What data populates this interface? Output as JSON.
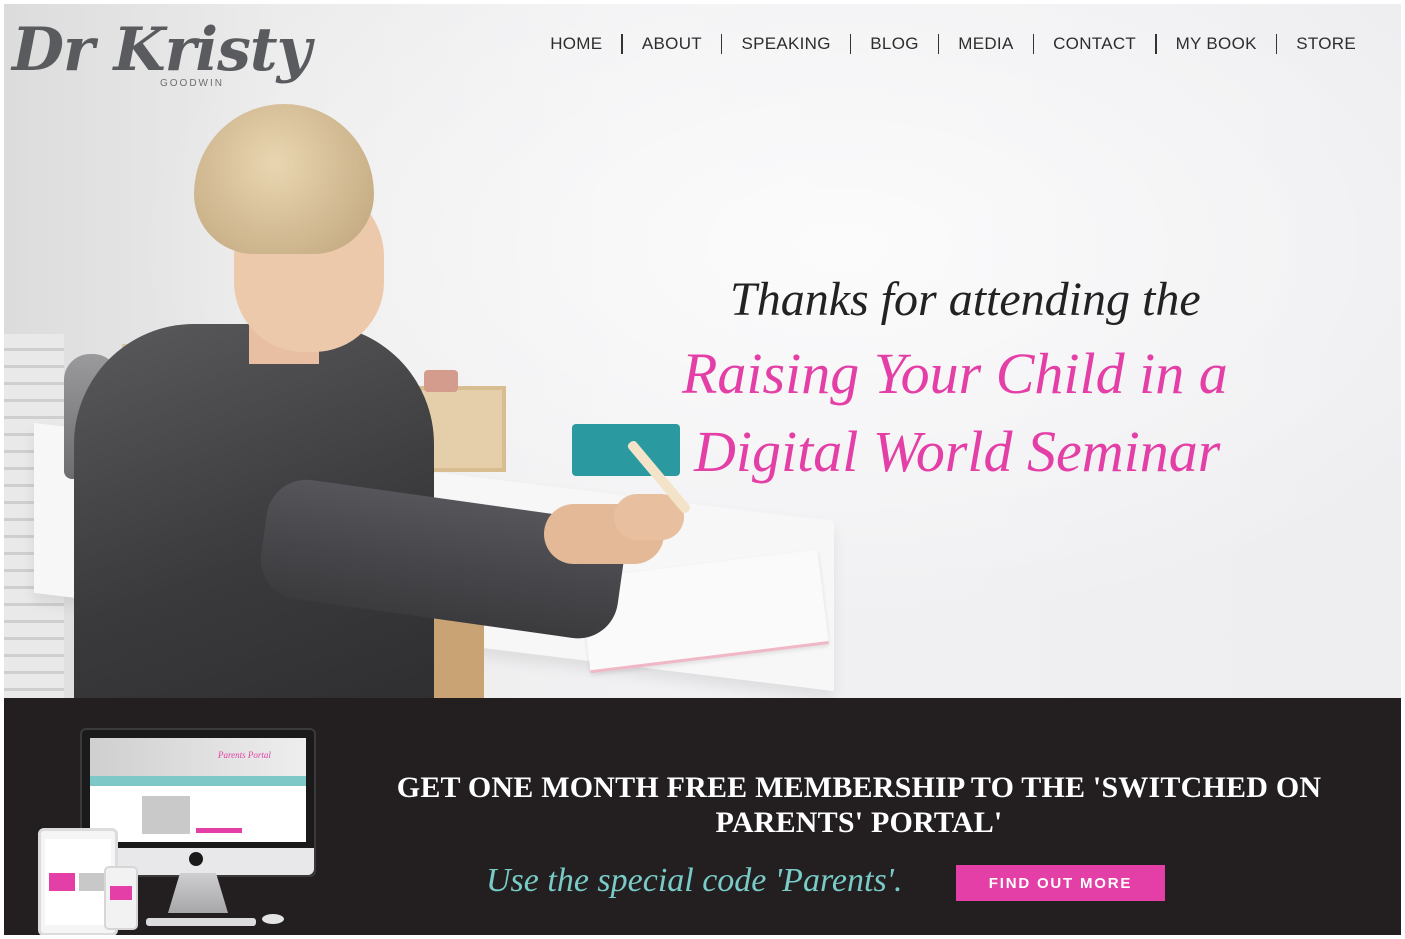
{
  "logo": {
    "main": "Dr Kristy",
    "sub": "GOODWIN"
  },
  "nav": {
    "items": [
      {
        "label": "HOME"
      },
      {
        "label": "ABOUT"
      },
      {
        "label": "SPEAKING"
      },
      {
        "label": "BLOG"
      },
      {
        "label": "MEDIA"
      },
      {
        "label": "CONTACT"
      },
      {
        "label": "MY BOOK"
      },
      {
        "label": "STORE"
      }
    ]
  },
  "hero": {
    "line1": "Thanks for attending the",
    "line2": "Raising Your Child in a",
    "line3": "Digital World Seminar",
    "accent_color": "#e33fa6"
  },
  "promo": {
    "title": "GET ONE MONTH FREE MEMBERSHIP TO THE 'SWITCHED ON PARENTS' PORTAL'",
    "code_text": "Use the special code 'Parents'.",
    "button_label": "FIND OUT MORE",
    "background": "#231f20",
    "code_color": "#79cbc7",
    "button_color": "#e33fa6",
    "device_screen_title": "Parents Portal"
  }
}
